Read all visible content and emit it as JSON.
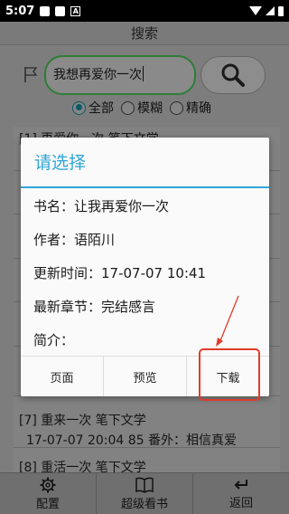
{
  "status_bar": {
    "time": "5:07",
    "notification_letter": "A"
  },
  "header": {
    "title": "搜索"
  },
  "search": {
    "value": "我想再爱你一次"
  },
  "search_modes": [
    {
      "label": "全部",
      "selected": true
    },
    {
      "label": "模糊",
      "selected": false
    },
    {
      "label": "精确",
      "selected": false
    }
  ],
  "results": {
    "partial_first": "[1] 再爱你一次 笔下文学",
    "item7_line1": "[7] 重来一次 笔下文学",
    "item7_line2": "17-07-07 20:04 85 番外：相信真爱",
    "item8_line1": "[8] 重活一次 笔下文学"
  },
  "bottom_nav": [
    {
      "label": "配置",
      "icon": "gear-icon"
    },
    {
      "label": "超级看书",
      "icon": "book-icon"
    },
    {
      "label": "返回",
      "icon": "return-icon"
    }
  ],
  "dialog": {
    "title": "请选择",
    "book_name": "书名：让我再爱你一次",
    "author": "作者：语陌川",
    "updated": "更新时间：17-07-07 10:41",
    "latest_chapter": "最新章节：完结感言",
    "summary": "简介：",
    "buttons": {
      "home": "页面",
      "preview": "预览",
      "download": "下载"
    }
  },
  "colors": {
    "accent": "#2fa7d9",
    "highlight": "#e13b2a",
    "search_border": "#2e7d36"
  }
}
